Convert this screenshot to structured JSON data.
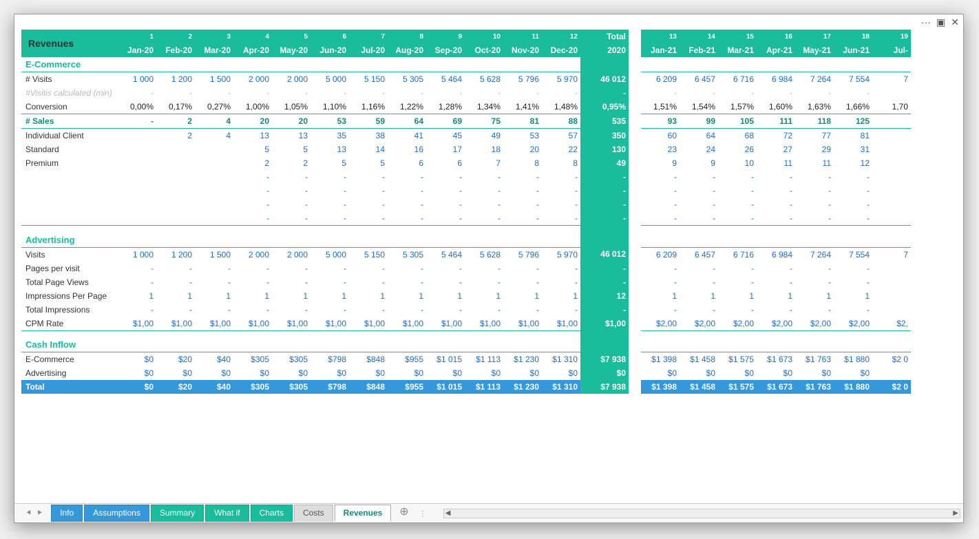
{
  "window": {
    "dots": "···",
    "grid_icon": "▣",
    "close": "✕"
  },
  "title": "Revenues",
  "months2020_idx": [
    "1",
    "2",
    "3",
    "4",
    "5",
    "6",
    "7",
    "8",
    "9",
    "10",
    "11",
    "12"
  ],
  "months2020": [
    "Jan-20",
    "Feb-20",
    "Mar-20",
    "Apr-20",
    "May-20",
    "Jun-20",
    "Jul-20",
    "Aug-20",
    "Sep-20",
    "Oct-20",
    "Nov-20",
    "Dec-20"
  ],
  "total_header": {
    "line1": "Total",
    "line2": "2020"
  },
  "months2021_idx": [
    "13",
    "14",
    "15",
    "16",
    "17",
    "18",
    "19"
  ],
  "months2021": [
    "Jan-21",
    "Feb-21",
    "Mar-21",
    "Apr-21",
    "May-21",
    "Jun-21",
    "Jul-"
  ],
  "sect_ecom": "E-Commerce",
  "visits_label": "# Visits",
  "visits_2020": [
    "1 000",
    "1 200",
    "1 500",
    "2 000",
    "2 000",
    "5 000",
    "5 150",
    "5 305",
    "5 464",
    "5 628",
    "5 796",
    "5 970"
  ],
  "visits_total": "46 012",
  "visits_2021": [
    "6 209",
    "6 457",
    "6 716",
    "6 984",
    "7 264",
    "7 554",
    "7"
  ],
  "visits_calc_label": "#Visitis calculated (min)",
  "dash": "-",
  "conv_label": "Conversion",
  "conv_2020": [
    "0,00%",
    "0,17%",
    "0,27%",
    "1,00%",
    "1,05%",
    "1,10%",
    "1,16%",
    "1,22%",
    "1,28%",
    "1,34%",
    "1,41%",
    "1,48%"
  ],
  "conv_total": "0,95%",
  "conv_2021": [
    "1,51%",
    "1,54%",
    "1,57%",
    "1,60%",
    "1,63%",
    "1,66%",
    "1,70"
  ],
  "sales_label": "# Sales",
  "sales_2020": [
    "-",
    "2",
    "4",
    "20",
    "20",
    "53",
    "59",
    "64",
    "69",
    "75",
    "81",
    "88"
  ],
  "sales_total": "535",
  "sales_2021": [
    "93",
    "99",
    "105",
    "111",
    "118",
    "125",
    ""
  ],
  "ind_label": "Individual Client",
  "ind_2020": [
    "",
    "2",
    "4",
    "13",
    "13",
    "35",
    "38",
    "41",
    "45",
    "49",
    "53",
    "57"
  ],
  "ind_total": "350",
  "ind_2021": [
    "60",
    "64",
    "68",
    "72",
    "77",
    "81",
    ""
  ],
  "std_label": "Standard",
  "std_2020": [
    "",
    "",
    "",
    "5",
    "5",
    "13",
    "14",
    "16",
    "17",
    "18",
    "20",
    "22"
  ],
  "std_total": "130",
  "std_2021": [
    "23",
    "24",
    "26",
    "27",
    "29",
    "31",
    ""
  ],
  "prem_label": "Premium",
  "prem_2020": [
    "",
    "",
    "",
    "2",
    "2",
    "5",
    "5",
    "6",
    "6",
    "7",
    "8",
    "8"
  ],
  "prem_total": "49",
  "prem_2021": [
    "9",
    "9",
    "10",
    "11",
    "11",
    "12",
    ""
  ],
  "sect_adv": "Advertising",
  "adv_visits_label": "Visits",
  "adv_visits_2020": [
    "1 000",
    "1 200",
    "1 500",
    "2 000",
    "2 000",
    "5 000",
    "5 150",
    "5 305",
    "5 464",
    "5 628",
    "5 796",
    "5 970"
  ],
  "adv_visits_total": "46 012",
  "adv_visits_2021": [
    "6 209",
    "6 457",
    "6 716",
    "6 984",
    "7 264",
    "7 554",
    "7"
  ],
  "ppv_label": "Pages per visit",
  "tpv_label": "Total Page Views",
  "ipp_label": "Impressions Per Page",
  "one": "1",
  "ipp_total": "12",
  "ti_label": "Total Impressions",
  "cpm_label": "CPM Rate",
  "cpm_2020": "$1,00",
  "cpm_total": "$1,00",
  "cpm_2021": "$2,00",
  "cpm_2021_last": "$2,",
  "sect_cash": "Cash Inflow",
  "ci_ecom_label": "E-Commerce",
  "ci_ecom_2020": [
    "$0",
    "$20",
    "$40",
    "$305",
    "$305",
    "$798",
    "$848",
    "$955",
    "$1 015",
    "$1 113",
    "$1 230",
    "$1 310"
  ],
  "ci_ecom_total": "$7 938",
  "ci_ecom_2021": [
    "$1 398",
    "$1 458",
    "$1 575",
    "$1 673",
    "$1 763",
    "$1 880",
    "$2 0"
  ],
  "ci_adv_label": "Advertising",
  "ci_adv_2020": "$0",
  "ci_adv_total": "$0",
  "total_label": "Total",
  "tot_2020": [
    "$0",
    "$20",
    "$40",
    "$305",
    "$305",
    "$798",
    "$848",
    "$955",
    "$1 015",
    "$1 113",
    "$1 230",
    "$1 310"
  ],
  "tot_total": "$7 938",
  "tot_2021": [
    "$1 398",
    "$1 458",
    "$1 575",
    "$1 673",
    "$1 763",
    "$1 880",
    "$2 0"
  ],
  "tabs": {
    "info": "Info",
    "assump": "Assumptions",
    "summary": "Summary",
    "whatif": "What if",
    "charts": "Charts",
    "costs": "Costs",
    "revenues": "Revenues"
  }
}
